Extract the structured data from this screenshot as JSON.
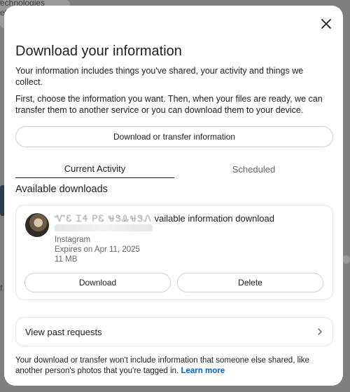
{
  "background": {
    "snippet_1": "echnologies",
    "snippet_2": "et",
    "snippet_3": "f"
  },
  "modal": {
    "close_icon": "close-icon",
    "title": "Download your information",
    "intro": "Your information includes things you've shared, your activity and things we collect.",
    "instructions": "First, choose the information you want. Then, when your files are ready, we can transfer them to another service or you can download them to your device.",
    "primary_button": "Download or transfer information",
    "tabs": [
      {
        "label": "Current Activity",
        "active": true
      },
      {
        "label": "Scheduled",
        "active": false
      }
    ],
    "section_title": "Available downloads",
    "download_item": {
      "title_obscured": "ᏉᏋ ᏆᏎ ᏢᏋ ᏠᏕᎲᏠᏕᏁ",
      "title_suffix": "vailable information download",
      "source": "Instagram",
      "expires": "Expires on Apr 11, 2025",
      "size": "11 MB",
      "download_button": "Download",
      "delete_button": "Delete"
    },
    "past_requests": "View past requests",
    "footer_text": "Your download or transfer won't include information that someone else shared, like another person's photos that you're tagged in.",
    "footer_link": "Learn more"
  },
  "colors": {
    "link": "#0064d1",
    "secondary_text": "#65676b",
    "border": "#ced0d4"
  }
}
